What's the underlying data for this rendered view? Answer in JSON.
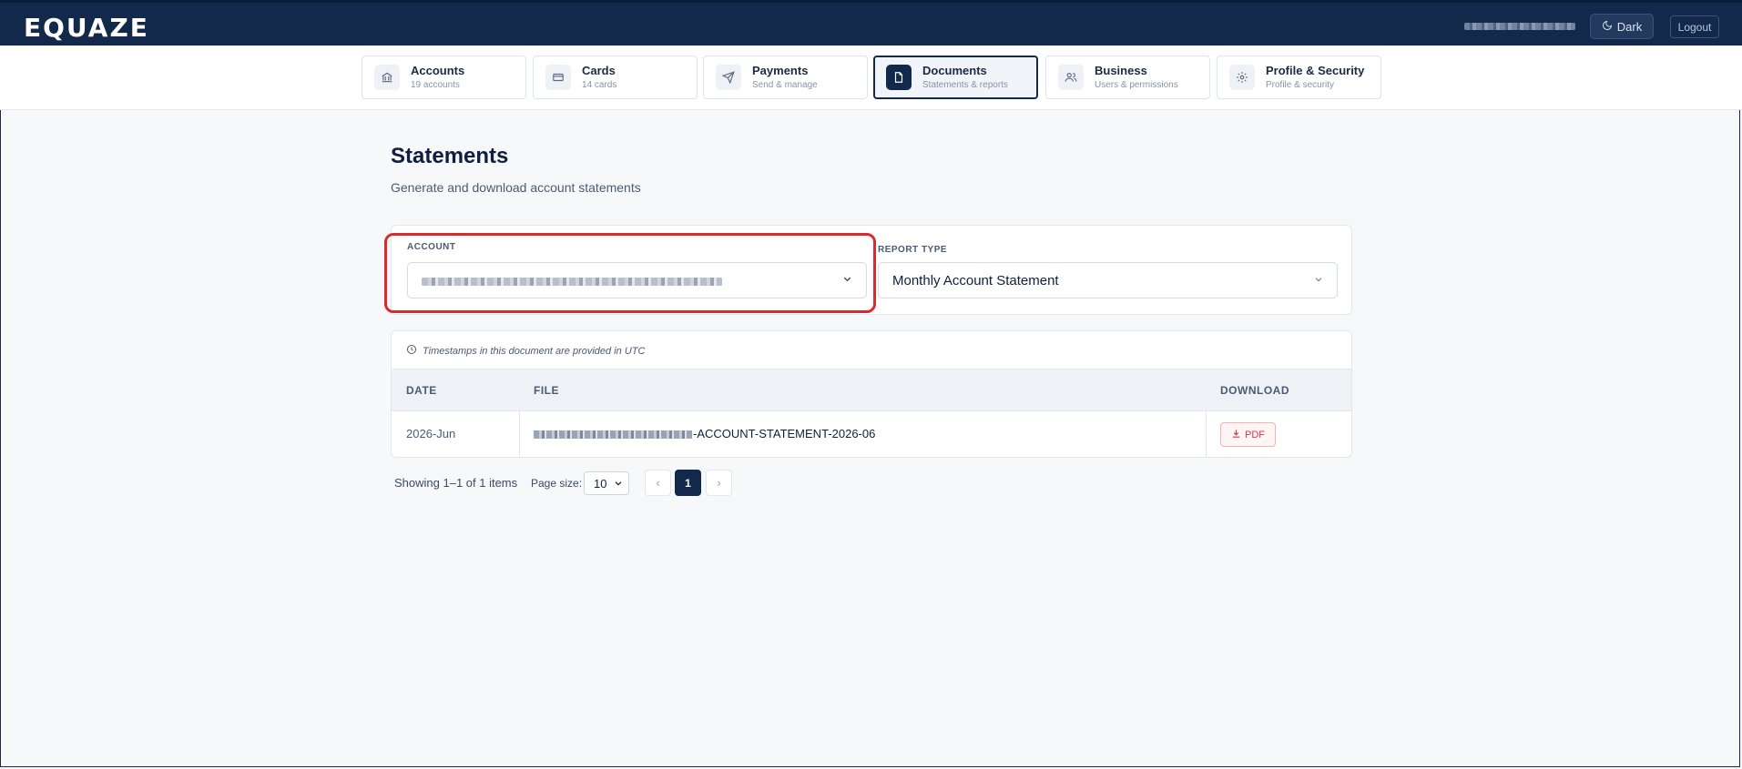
{
  "app": {
    "logo": "EQUAZE"
  },
  "header": {
    "dark_label": "Dark",
    "logout_label": "Logout"
  },
  "nav": [
    {
      "title": "Accounts",
      "sub": "19 accounts",
      "icon": "bank-icon"
    },
    {
      "title": "Cards",
      "sub": "14 cards",
      "icon": "card-icon"
    },
    {
      "title": "Payments",
      "sub": "Send & manage",
      "icon": "send-icon"
    },
    {
      "title": "Documents",
      "sub": "Statements & reports",
      "icon": "document-icon",
      "active": true
    },
    {
      "title": "Business",
      "sub": "Users & permissions",
      "icon": "users-icon"
    },
    {
      "title": "Profile & Security",
      "sub": "Profile & security",
      "icon": "gear-icon"
    }
  ],
  "page": {
    "title": "Statements",
    "subtitle": "Generate and download account statements"
  },
  "filters": {
    "account_label": "ACCOUNT",
    "report_type_label": "REPORT TYPE",
    "report_type_value": "Monthly Account Statement"
  },
  "table": {
    "tz_note": "Timestamps in this document are provided in UTC",
    "headers": {
      "date": "DATE",
      "file": "FILE",
      "download": "DOWNLOAD"
    },
    "rows": [
      {
        "date": "2026-Jun",
        "file_suffix": "-ACCOUNT-STATEMENT-2026-06",
        "download_label": "PDF"
      }
    ]
  },
  "pagination": {
    "info": "Showing 1–1 of 1 items",
    "page_size_label": "Page size:",
    "page_size": "10",
    "prev": "‹",
    "current": "1",
    "next": "›"
  },
  "colors": {
    "brand": "#13294b",
    "highlight": "#d92b2b",
    "pdf": "#d93a3a"
  }
}
